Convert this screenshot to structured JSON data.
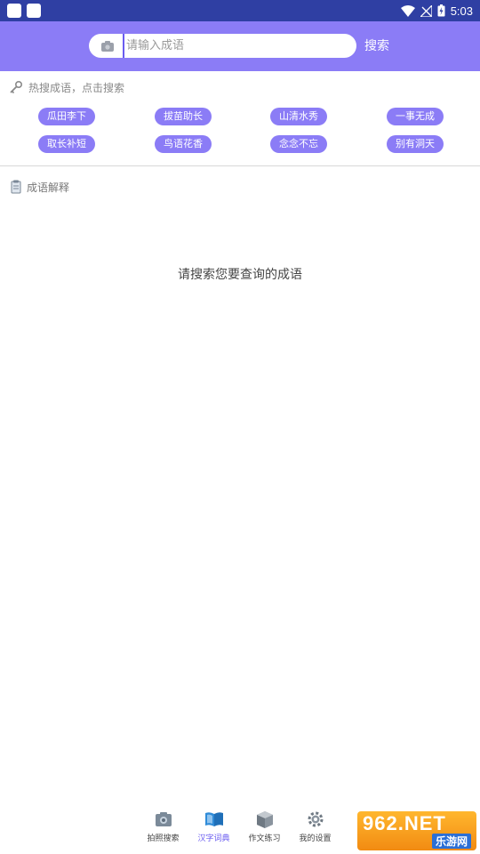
{
  "status_bar": {
    "time": "5:03"
  },
  "header": {
    "search_placeholder": "请输入成语",
    "search_button": "搜索"
  },
  "hot": {
    "title": "热搜成语，点击搜索",
    "chips": [
      "瓜田李下",
      "拔苗助长",
      "山清水秀",
      "一事无成",
      "取长补短",
      "鸟语花香",
      "念念不忘",
      "别有洞天"
    ]
  },
  "explain": {
    "title": "成语解释",
    "empty_message": "请搜索您要查询的成语"
  },
  "nav": {
    "items": [
      {
        "label": "拍照搜索",
        "icon": "camera-icon"
      },
      {
        "label": "汉字词典",
        "icon": "book-icon"
      },
      {
        "label": "作文练习",
        "icon": "box-icon"
      },
      {
        "label": "我的设置",
        "icon": "gear-icon"
      }
    ],
    "active_index": 1
  },
  "watermark": {
    "top": "962.NET",
    "bottom": "乐游网"
  },
  "colors": {
    "accent": "#8b7cf6",
    "status_bar": "#2f3fa3",
    "active_nav": "#6a5cf0"
  }
}
